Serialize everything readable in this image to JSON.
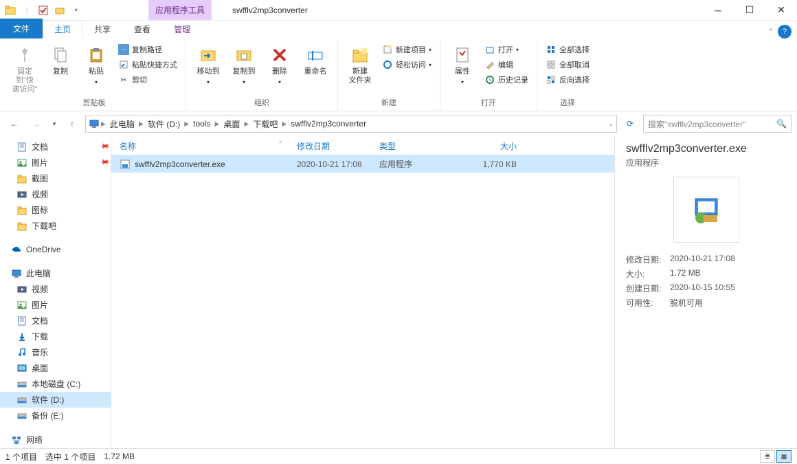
{
  "titlebar": {
    "contextual_label": "应用程序工具",
    "title": "swfflv2mp3converter"
  },
  "tabs": {
    "file": "文件",
    "home": "主页",
    "share": "共享",
    "view": "查看",
    "manage": "管理"
  },
  "ribbon": {
    "pin": {
      "label": "固定到\"快\n速访问\""
    },
    "copy": "复制",
    "paste": "粘贴",
    "copy_path": "复制路径",
    "paste_shortcut": "粘贴快捷方式",
    "cut": "剪切",
    "clipboard_group": "剪贴板",
    "move_to": "移动到",
    "copy_to": "复制到",
    "delete": "删除",
    "rename": "重命名",
    "organize_group": "组织",
    "new_folder": "新建\n文件夹",
    "new_item": "新建项目",
    "easy_access": "轻松访问",
    "new_group": "新建",
    "properties": "属性",
    "open": "打开",
    "edit": "编辑",
    "history": "历史记录",
    "open_group": "打开",
    "select_all": "全部选择",
    "select_none": "全部取消",
    "invert_selection": "反向选择",
    "select_group": "选择"
  },
  "breadcrumbs": [
    "此电脑",
    "软件 (D:)",
    "tools",
    "桌面",
    "下载吧",
    "swfflv2mp3converter"
  ],
  "search": {
    "placeholder": "搜索\"swfflv2mp3converter\""
  },
  "sidebar": {
    "items": [
      {
        "label": "文档",
        "icon": "doc",
        "indent": 2,
        "pinned": true
      },
      {
        "label": "图片",
        "icon": "pic",
        "indent": 2,
        "pinned": true
      },
      {
        "label": "截图",
        "icon": "folder",
        "indent": 2
      },
      {
        "label": "视频",
        "icon": "video",
        "indent": 2
      },
      {
        "label": "图标",
        "icon": "folder",
        "indent": 2
      },
      {
        "label": "下载吧",
        "icon": "folder",
        "indent": 2
      },
      {
        "label": "OneDrive",
        "icon": "onedrive",
        "indent": 1,
        "spaced": true
      },
      {
        "label": "此电脑",
        "icon": "pc",
        "indent": 1,
        "spaced": true
      },
      {
        "label": "视频",
        "icon": "video",
        "indent": 2
      },
      {
        "label": "图片",
        "icon": "pic",
        "indent": 2
      },
      {
        "label": "文档",
        "icon": "doc",
        "indent": 2
      },
      {
        "label": "下载",
        "icon": "download",
        "indent": 2
      },
      {
        "label": "音乐",
        "icon": "music",
        "indent": 2
      },
      {
        "label": "桌面",
        "icon": "desktop",
        "indent": 2
      },
      {
        "label": "本地磁盘 (C:)",
        "icon": "disk",
        "indent": 2
      },
      {
        "label": "软件 (D:)",
        "icon": "disk",
        "indent": 2,
        "selected": true
      },
      {
        "label": "备份 (E:)",
        "icon": "disk",
        "indent": 2
      },
      {
        "label": "网络",
        "icon": "network",
        "indent": 1,
        "spaced": true
      }
    ]
  },
  "columns": {
    "name": "名称",
    "date": "修改日期",
    "type": "类型",
    "size": "大小"
  },
  "files": [
    {
      "name": "swfflv2mp3converter.exe",
      "date": "2020-10-21 17:08",
      "type": "应用程序",
      "size": "1,770 KB"
    }
  ],
  "details": {
    "title": "swfflv2mp3converter.exe",
    "type": "应用程序",
    "rows": [
      {
        "label": "修改日期:",
        "value": "2020-10-21 17:08"
      },
      {
        "label": "大小:",
        "value": "1.72 MB"
      },
      {
        "label": "创建日期:",
        "value": "2020-10-15 10:55"
      },
      {
        "label": "可用性:",
        "value": "脱机可用"
      }
    ]
  },
  "statusbar": {
    "count": "1 个项目",
    "selected": "选中 1 个项目",
    "size": "1.72 MB"
  }
}
